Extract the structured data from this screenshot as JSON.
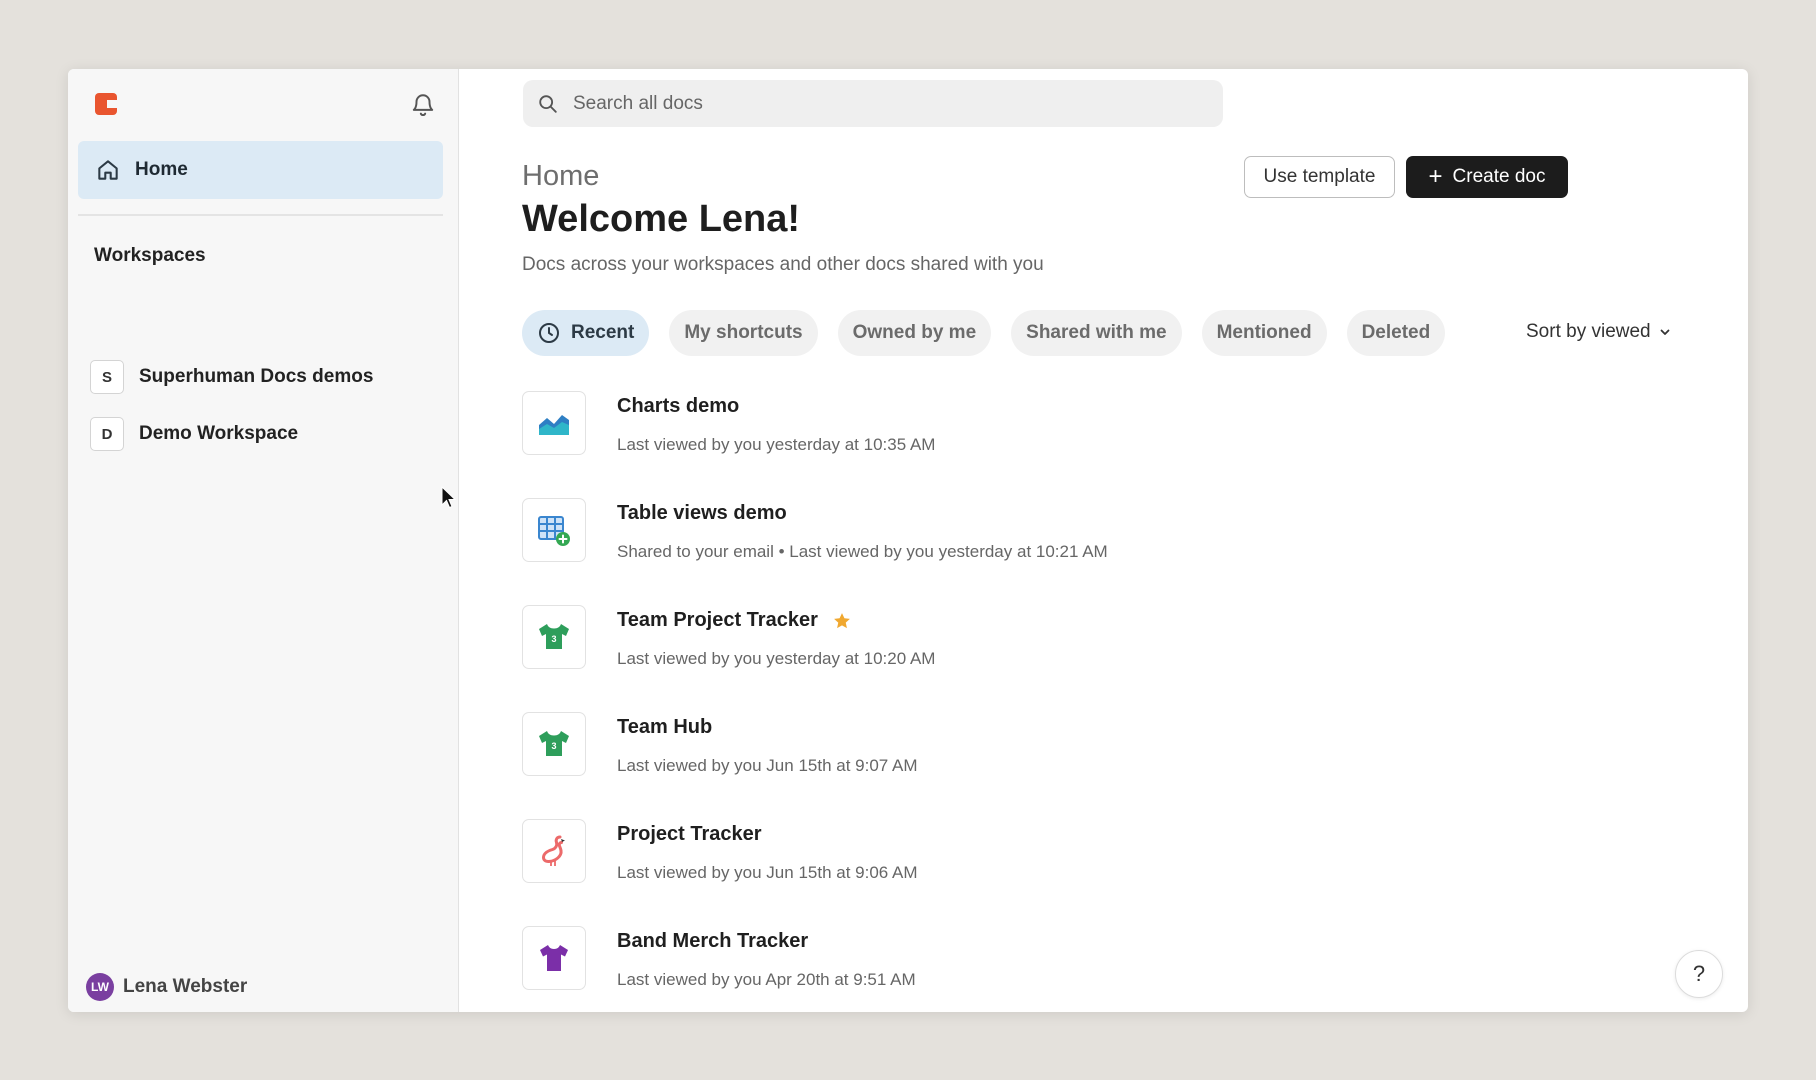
{
  "sidebar": {
    "home_label": "Home",
    "workspaces_heading": "Workspaces",
    "workspaces": [
      {
        "badge": "S",
        "label": "Superhuman Docs demos"
      },
      {
        "badge": "D",
        "label": "Demo Workspace"
      }
    ],
    "user": {
      "initials": "LW",
      "name": "Lena Webster"
    }
  },
  "search": {
    "placeholder": "Search all docs"
  },
  "header": {
    "breadcrumb": "Home",
    "title": "Welcome Lena!",
    "subtitle": "Docs across your workspaces and other docs shared with you",
    "use_template_label": "Use template",
    "create_doc_label": "Create doc"
  },
  "tabs": [
    {
      "label": "Recent",
      "active": true
    },
    {
      "label": "My shortcuts"
    },
    {
      "label": "Owned by me"
    },
    {
      "label": "Shared with me"
    },
    {
      "label": "Mentioned"
    },
    {
      "label": "Deleted"
    }
  ],
  "sort_label": "Sort by viewed",
  "docs": [
    {
      "title": "Charts demo",
      "meta": "Last viewed by you yesterday at 10:35 AM",
      "icon": "chart-icon"
    },
    {
      "title": "Table views demo",
      "meta": "Shared to your email • Last viewed by you yesterday at 10:21 AM",
      "icon": "table-icon"
    },
    {
      "title": "Team Project Tracker",
      "meta": "Last viewed by you yesterday at 10:20 AM",
      "icon": "jersey-icon",
      "starred": true
    },
    {
      "title": "Team Hub",
      "meta": "Last viewed by you Jun 15th at 9:07 AM",
      "icon": "jersey-icon"
    },
    {
      "title": "Project Tracker",
      "meta": "Last viewed by you Jun 15th at 9:06 AM",
      "icon": "flamingo-icon"
    },
    {
      "title": "Band Merch Tracker",
      "meta": "Last viewed by you Apr 20th at 9:51 AM",
      "icon": "tshirt-icon"
    }
  ],
  "help_label": "?",
  "colors": {
    "brand": "#e9552f",
    "active_bg": "#dceaf5",
    "primary_button": "#1c1c1c",
    "star": "#f0a830",
    "avatar": "#7a3fa0"
  }
}
